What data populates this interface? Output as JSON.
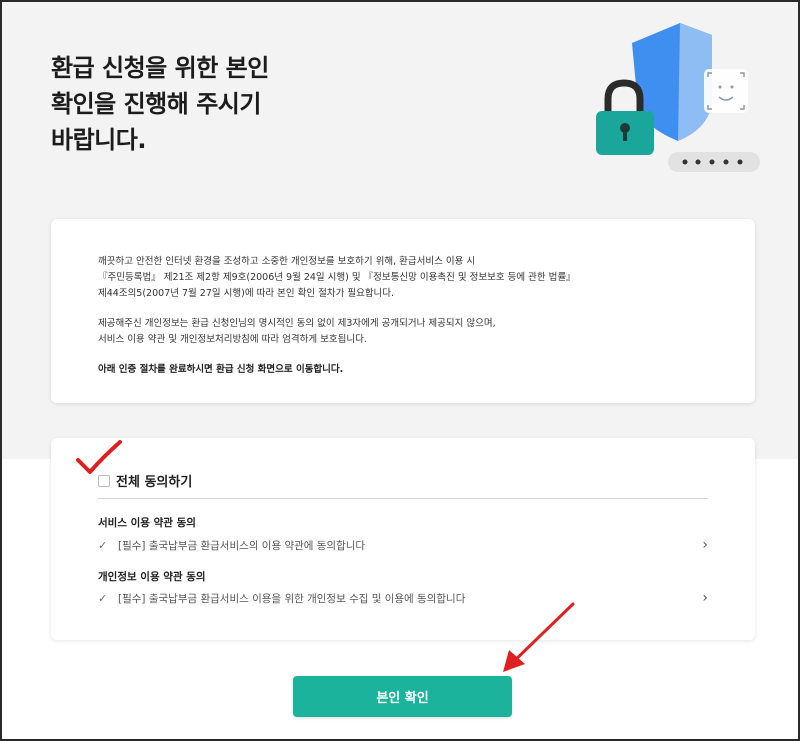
{
  "header": {
    "title": "환급 신청을 위한 본인\n확인을 진행해 주시기\n바랍니다."
  },
  "illustration": {
    "icons": [
      "shield-icon",
      "lock-icon",
      "face-id-icon",
      "password-dots-icon"
    ],
    "colors": {
      "shield": "#3f8ff0",
      "lock": "#1aa69a",
      "dots_bg": "#e2e2e2"
    }
  },
  "notice": {
    "paragraphs": [
      "깨끗하고 안전한 인터넷 환경을 조성하고 소중한 개인정보를 보호하기 위해, 환급서비스 이용 시\n『주민등록법』 제21조 제2항 제9호(2006년 9월 24일 시행) 및 『정보통신망 이용촉진 및 정보보호 등에 관한 법률』\n제44조의5(2007년 7월 27일 시행)에 따라 본인 확인 절차가 필요합니다.",
      "제공해주신 개인정보는 환급 신청인님의 명시적인 동의 없이 제3자에게 공개되거나 제공되지 않으며,\n서비스 이용 약관 및 개인정보처리방침에 따라 엄격하게 보호됩니다.",
      "아래 인증 절차를 완료하시면 환급 신청 화면으로 이동합니다."
    ]
  },
  "agreement": {
    "all_label": "전체 동의하기",
    "sections": [
      {
        "title": "서비스 이용 약관 동의",
        "item": "[필수] 출국납부금 환급서비스의 이용 약관에 동의합니다"
      },
      {
        "title": "개인정보 이용 약관 동의",
        "item": "[필수] 출국납부금 환급서비스 이용을 위한 개인정보 수집 및 이용에 동의합니다"
      }
    ],
    "check_glyph": "✓",
    "chevron_glyph": "›"
  },
  "confirm": {
    "label": "본인 확인"
  },
  "colors": {
    "accent": "#1cb39c",
    "annotation": "#e02020",
    "background": "#f3f3f3"
  }
}
